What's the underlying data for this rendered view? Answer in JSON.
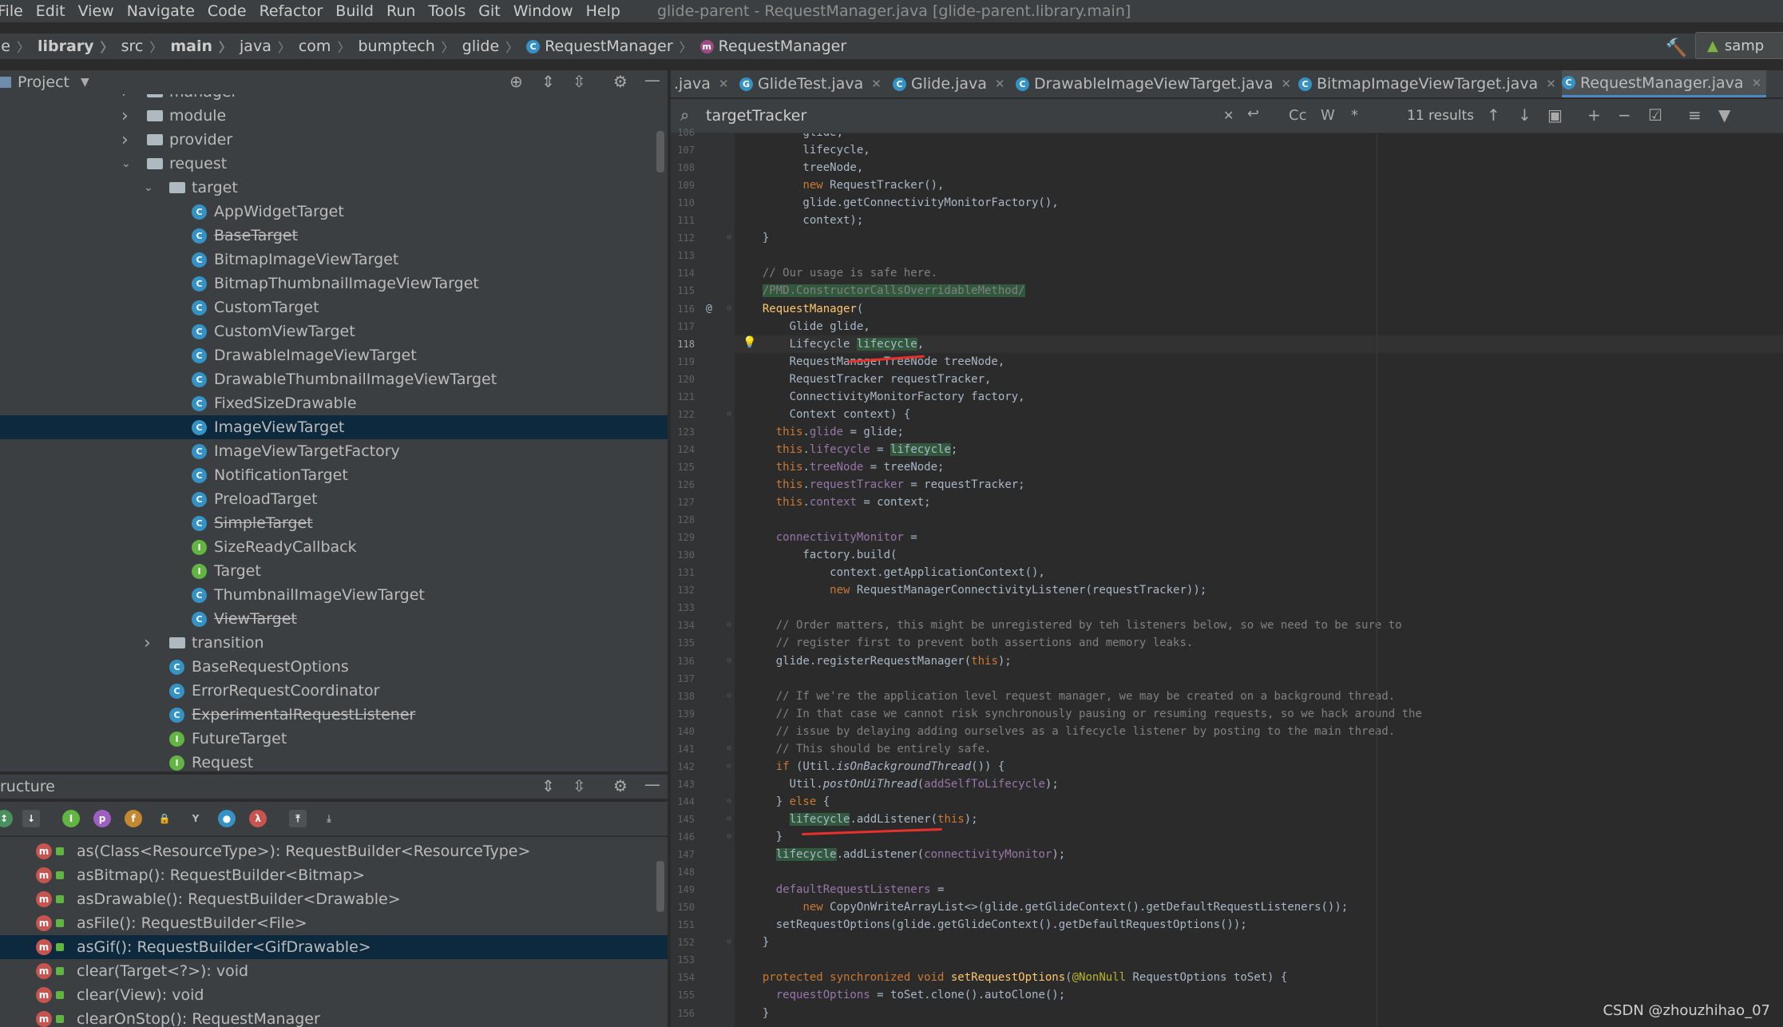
{
  "menu": [
    "File",
    "Edit",
    "View",
    "Navigate",
    "Code",
    "Refactor",
    "Build",
    "Run",
    "Tools",
    "Git",
    "Window",
    "Help"
  ],
  "window_title": "glide-parent - RequestManager.java [glide-parent.library.main]",
  "breadcrumbs": [
    "le",
    "library",
    "src",
    "main",
    "java",
    "com",
    "bumptech",
    "glide",
    "RequestManager",
    "RequestManager"
  ],
  "run_config": "samp",
  "project_panel": {
    "title": "Project",
    "tree": [
      {
        "label": "manager",
        "type": "folder",
        "level": 1,
        "expanded": false
      },
      {
        "label": "module",
        "type": "folder",
        "level": 1,
        "expanded": false
      },
      {
        "label": "provider",
        "type": "folder",
        "level": 1,
        "expanded": false
      },
      {
        "label": "request",
        "type": "folder",
        "level": 1,
        "expanded": true
      },
      {
        "label": "target",
        "type": "folder",
        "level": 2,
        "expanded": true
      },
      {
        "label": "AppWidgetTarget",
        "type": "class",
        "level": 3
      },
      {
        "label": "BaseTarget",
        "type": "abstract",
        "level": 3,
        "deprecated": true
      },
      {
        "label": "BitmapImageViewTarget",
        "type": "class",
        "level": 3
      },
      {
        "label": "BitmapThumbnailImageViewTarget",
        "type": "class",
        "level": 3
      },
      {
        "label": "CustomTarget",
        "type": "abstract",
        "level": 3
      },
      {
        "label": "CustomViewTarget",
        "type": "abstract",
        "level": 3
      },
      {
        "label": "DrawableImageViewTarget",
        "type": "class",
        "level": 3
      },
      {
        "label": "DrawableThumbnailImageViewTarget",
        "type": "class",
        "level": 3
      },
      {
        "label": "FixedSizeDrawable",
        "type": "class",
        "level": 3
      },
      {
        "label": "ImageViewTarget",
        "type": "abstract",
        "level": 3,
        "selected": true
      },
      {
        "label": "ImageViewTargetFactory",
        "type": "class",
        "level": 3
      },
      {
        "label": "NotificationTarget",
        "type": "class",
        "level": 3
      },
      {
        "label": "PreloadTarget",
        "type": "class",
        "level": 3
      },
      {
        "label": "SimpleTarget",
        "type": "abstract",
        "level": 3,
        "deprecated": true
      },
      {
        "label": "SizeReadyCallback",
        "type": "interface",
        "level": 3
      },
      {
        "label": "Target",
        "type": "interface",
        "level": 3
      },
      {
        "label": "ThumbnailImageViewTarget",
        "type": "abstract",
        "level": 3
      },
      {
        "label": "ViewTarget",
        "type": "abstract",
        "level": 3,
        "deprecated": true
      },
      {
        "label": "transition",
        "type": "folder",
        "level": 2,
        "expanded": false
      },
      {
        "label": "BaseRequestOptions",
        "type": "abstract",
        "level": 2
      },
      {
        "label": "ErrorRequestCoordinator",
        "type": "class",
        "level": 2
      },
      {
        "label": "ExperimentalRequestListener",
        "type": "abstract",
        "level": 2,
        "deprecated": true
      },
      {
        "label": "FutureTarget",
        "type": "interface",
        "level": 2
      },
      {
        "label": "Request",
        "type": "interface",
        "level": 2
      }
    ]
  },
  "structure_panel": {
    "title": "ructure",
    "items": [
      {
        "label": "as(Class<ResourceType>): RequestBuilder<ResourceType>"
      },
      {
        "label": "asBitmap(): RequestBuilder<Bitmap>"
      },
      {
        "label": "asDrawable(): RequestBuilder<Drawable>"
      },
      {
        "label": "asFile(): RequestBuilder<File>"
      },
      {
        "label": "asGif(): RequestBuilder<GifDrawable>",
        "selected": true
      },
      {
        "label": "clear(Target<?>): void"
      },
      {
        "label": "clear(View): void"
      },
      {
        "label": "clearOnStop(): RequestManager"
      }
    ]
  },
  "tabs": [
    {
      "label": ".java"
    },
    {
      "label": "GlideTest.java"
    },
    {
      "label": "Glide.java"
    },
    {
      "label": "DrawableImageViewTarget.java"
    },
    {
      "label": "BitmapImageViewTarget.java"
    },
    {
      "label": "RequestManager.java",
      "active": true
    }
  ],
  "search": {
    "query": "targetTracker",
    "results": "11 results",
    "match_case": "Cc",
    "words": "W",
    "regex": "*"
  },
  "editor": {
    "first_line": 106,
    "current_line": 118,
    "lines": [
      {
        "n": 106,
        "html": "        glide,"
      },
      {
        "n": 107,
        "html": "        lifecycle,"
      },
      {
        "n": 108,
        "html": "        treeNode,"
      },
      {
        "n": 109,
        "html": "        <span class='kw'>new</span> RequestTracker(),"
      },
      {
        "n": 110,
        "html": "        glide.getConnectivityMonitorFactory(),"
      },
      {
        "n": 111,
        "html": "        context);"
      },
      {
        "n": 112,
        "html": "  }"
      },
      {
        "n": 113,
        "html": ""
      },
      {
        "n": 114,
        "html": "  <span class='cm'>// Our usage is safe here.</span>"
      },
      {
        "n": 115,
        "html": "  <span class='cm hl'>/PMD.ConstructorCallsOverridableMethod/</span>"
      },
      {
        "n": 116,
        "html": "  <span class='fn'>RequestManager</span>("
      },
      {
        "n": 117,
        "html": "      Glide glide,"
      },
      {
        "n": 118,
        "html": "      Lifecycle <span class='hl'>lifecycle</span>,"
      },
      {
        "n": 119,
        "html": "      RequestManagerTreeNode treeNode,"
      },
      {
        "n": 120,
        "html": "      RequestTracker requestTracker,"
      },
      {
        "n": 121,
        "html": "      ConnectivityMonitorFactory factory,"
      },
      {
        "n": 122,
        "html": "      Context context) {"
      },
      {
        "n": 123,
        "html": "    <span class='kw'>this</span>.<span class='fld'>glide</span> = glide;"
      },
      {
        "n": 124,
        "html": "    <span class='kw'>this</span>.<span class='fld'>lifecycle</span> = <span class='hl'>lifecycle</span>;"
      },
      {
        "n": 125,
        "html": "    <span class='kw'>this</span>.<span class='fld'>treeNode</span> = treeNode;"
      },
      {
        "n": 126,
        "html": "    <span class='kw'>this</span>.<span class='fld'>requestTracker</span> = requestTracker;"
      },
      {
        "n": 127,
        "html": "    <span class='kw'>this</span>.<span class='fld'>context</span> = context;"
      },
      {
        "n": 128,
        "html": ""
      },
      {
        "n": 129,
        "html": "    <span class='fld'>connectivityMonitor</span> ="
      },
      {
        "n": 130,
        "html": "        factory.build("
      },
      {
        "n": 131,
        "html": "            context.getApplicationContext(),"
      },
      {
        "n": 132,
        "html": "            <span class='kw'>new</span> RequestManagerConnectivityListener(requestTracker));"
      },
      {
        "n": 133,
        "html": ""
      },
      {
        "n": 134,
        "html": "    <span class='cm'>// Order matters, this might be unregistered by teh listeners below, so we need to be sure to</span>"
      },
      {
        "n": 135,
        "html": "    <span class='cm'>// register first to prevent both assertions and memory leaks.</span>"
      },
      {
        "n": 136,
        "html": "    glide.registerRequestManager(<span class='kw'>this</span>);"
      },
      {
        "n": 137,
        "html": ""
      },
      {
        "n": 138,
        "html": "    <span class='cm'>// If we're the application level request manager, we may be created on a background thread.</span>"
      },
      {
        "n": 139,
        "html": "    <span class='cm'>// In that case we cannot risk synchronously pausing or resuming requests, so we hack around the</span>"
      },
      {
        "n": 140,
        "html": "    <span class='cm'>// issue by delaying adding ourselves as a lifecycle listener by posting to the main thread.</span>"
      },
      {
        "n": 141,
        "html": "    <span class='cm'>// This should be entirely safe.</span>"
      },
      {
        "n": 142,
        "html": "    <span class='kw'>if</span> (Util.<span class='it'>isOnBackgroundThread</span>()) {"
      },
      {
        "n": 143,
        "html": "      Util.<span class='it'>postOnUiThread</span>(<span class='fld'>addSelfToLifecycle</span>);"
      },
      {
        "n": 144,
        "html": "    } <span class='kw'>else</span> {"
      },
      {
        "n": 145,
        "html": "      <span class='hl'>lifecycle</span>.addListener(<span class='kw'>this</span>);"
      },
      {
        "n": 146,
        "html": "    }"
      },
      {
        "n": 147,
        "html": "    <span class='hl'>lifecycle</span>.addListener(<span class='fld'>connectivityMonitor</span>);"
      },
      {
        "n": 148,
        "html": ""
      },
      {
        "n": 149,
        "html": "    <span class='fld'>defaultRequestListeners</span> ="
      },
      {
        "n": 150,
        "html": "        <span class='kw'>new</span> CopyOnWriteArrayList&lt;&gt;(glide.getGlideContext().getDefaultRequestListeners());"
      },
      {
        "n": 151,
        "html": "    setRequestOptions(glide.getGlideContext().getDefaultRequestOptions());"
      },
      {
        "n": 152,
        "html": "  }"
      },
      {
        "n": 153,
        "html": ""
      },
      {
        "n": 154,
        "html": "  <span class='kw'>protected synchronized void</span> <span class='fn'>setRequestOptions</span>(<span class='ann'>@NonNull</span> RequestOptions toSet) {"
      },
      {
        "n": 155,
        "html": "    <span class='fld'>requestOptions</span> = toSet.clone().autoClone();"
      },
      {
        "n": 156,
        "html": "  }"
      }
    ]
  },
  "watermark": "CSDN @zhouzhihao_07"
}
